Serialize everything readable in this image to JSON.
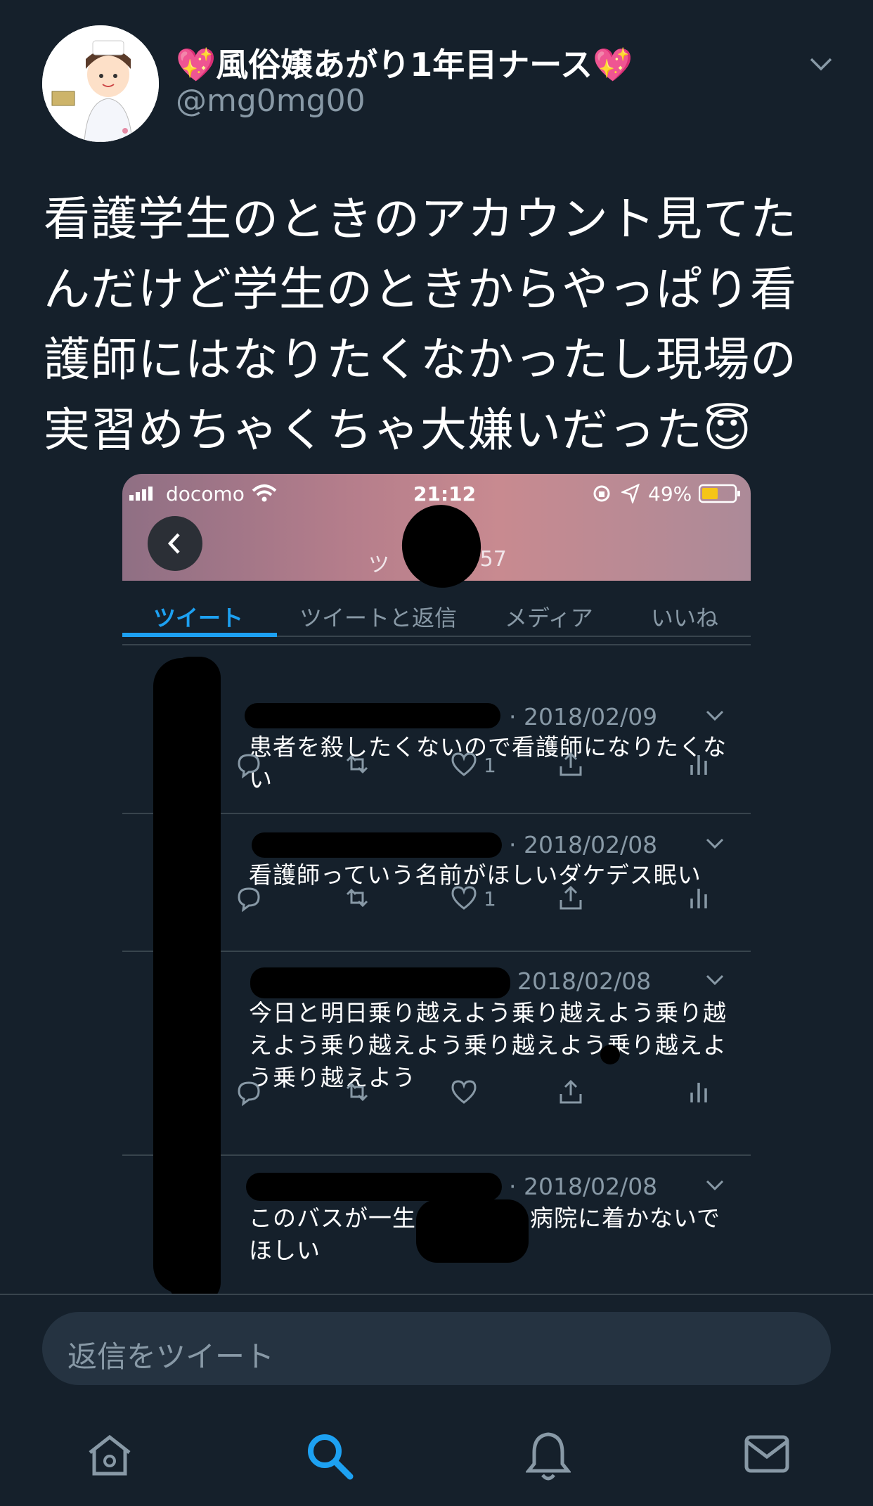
{
  "tweet": {
    "display_name": "💖風俗嬢あがり1年目ナース💖",
    "handle": "@mg0mg00",
    "lines": [
      "看護学生のときのアカウント見てた",
      "んだけど学生のときからやっぱり看",
      "護師にはなりたくなかったし現場の",
      "実習めちゃくちゃ大嫌いだった😇"
    ]
  },
  "embedded": {
    "status": {
      "carrier": "docomo",
      "time": "21:12",
      "battery": "49%"
    },
    "header": {
      "count_prefix": "ツ",
      "count_suffix": ",357"
    },
    "tabs": [
      "ツイート",
      "ツイートと返信",
      "メディア",
      "いいね"
    ],
    "tweets": [
      {
        "date": "· 2018/02/09",
        "lines": [
          "患者を殺したくないので看護師になりたくな",
          "い"
        ],
        "likes": "1"
      },
      {
        "date": "· 2018/02/08",
        "lines": [
          "看護師っていう名前がほしいダケデス眠い"
        ],
        "likes": "1"
      },
      {
        "date": "2018/02/08",
        "lines": [
          "今日と明日乗り越えよう乗り越えよう乗り越",
          "えよう乗り越えよう乗り越えよう乗り越えよ",
          "う乗り越えよう"
        ],
        "likes": ""
      },
      {
        "date": "· 2018/02/08",
        "lines": [
          "このバスが一生",
          "病院に着かないで",
          "ほしい"
        ],
        "likes": ""
      }
    ]
  },
  "reply": {
    "placeholder": "返信をツイート"
  },
  "nav": {
    "icons": [
      "home-icon",
      "search-icon",
      "bell-icon",
      "mail-icon"
    ],
    "active": "search-icon"
  },
  "colors": {
    "background": "#15202b",
    "accent": "#1da1f2",
    "muted": "#8899a6",
    "divider": "#38444d"
  }
}
